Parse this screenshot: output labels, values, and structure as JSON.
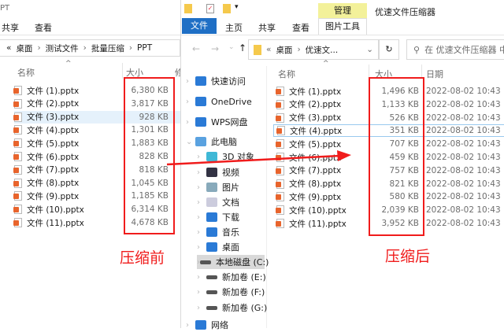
{
  "left": {
    "title": "PT",
    "tabs": [
      "共享",
      "查看"
    ],
    "breadcrumb": [
      "桌面",
      "测试文件",
      "批量压缩",
      "PPT"
    ],
    "columns": {
      "name": "名称",
      "size": "大小",
      "modified": "修"
    },
    "files": [
      {
        "name": "文件 (1).pptx",
        "size": "6,380 KB"
      },
      {
        "name": "文件 (2).pptx",
        "size": "3,817 KB"
      },
      {
        "name": "文件 (3).pptx",
        "size": "928 KB"
      },
      {
        "name": "文件 (4).pptx",
        "size": "1,301 KB"
      },
      {
        "name": "文件 (5).pptx",
        "size": "1,883 KB"
      },
      {
        "name": "文件 (6).pptx",
        "size": "828 KB"
      },
      {
        "name": "文件 (7).pptx",
        "size": "818 KB"
      },
      {
        "name": "文件 (8).pptx",
        "size": "1,045 KB"
      },
      {
        "name": "文件 (9).pptx",
        "size": "1,185 KB"
      },
      {
        "name": "文件 (10).pptx",
        "size": "6,314 KB"
      },
      {
        "name": "文件 (11).pptx",
        "size": "4,678 KB"
      }
    ],
    "annotation": "压缩前"
  },
  "right": {
    "title": "优速文件压缩器",
    "context_tab": "管理",
    "context_subtab": "图片工具",
    "tabs": [
      "文件",
      "主页",
      "共享",
      "查看"
    ],
    "breadcrumb": [
      "桌面",
      "优速文..."
    ],
    "search_placeholder": "在 优速文件压缩器 中",
    "columns": {
      "name": "名称",
      "size": "大小",
      "date": "日期"
    },
    "sidebar": [
      {
        "label": "快速访问",
        "icon": "star-icon"
      },
      {
        "label": "OneDrive",
        "icon": "cloud-icon"
      },
      {
        "label": "WPS网盘",
        "icon": "cloud-icon"
      },
      {
        "label": "此电脑",
        "icon": "computer-icon"
      },
      {
        "label": "3D 对象",
        "icon": "cube-icon"
      },
      {
        "label": "视频",
        "icon": "video-icon"
      },
      {
        "label": "图片",
        "icon": "picture-icon"
      },
      {
        "label": "文档",
        "icon": "document-icon"
      },
      {
        "label": "下载",
        "icon": "download-icon"
      },
      {
        "label": "音乐",
        "icon": "music-icon"
      },
      {
        "label": "桌面",
        "icon": "desktop-icon"
      },
      {
        "label": "本地磁盘 (C:)",
        "icon": "drive-icon"
      },
      {
        "label": "新加卷 (E:)",
        "icon": "drive-icon"
      },
      {
        "label": "新加卷 (F:)",
        "icon": "drive-icon"
      },
      {
        "label": "新加卷 (G:)",
        "icon": "drive-icon"
      },
      {
        "label": "网络",
        "icon": "network-icon"
      }
    ],
    "files": [
      {
        "name": "文件 (1).pptx",
        "size": "1,496 KB",
        "date": "2022-08-02 10:43"
      },
      {
        "name": "文件 (2).pptx",
        "size": "1,133 KB",
        "date": "2022-08-02 10:43"
      },
      {
        "name": "文件 (3).pptx",
        "size": "526 KB",
        "date": "2022-08-02 10:43"
      },
      {
        "name": "文件 (4).pptx",
        "size": "351 KB",
        "date": "2022-08-02 10:43"
      },
      {
        "name": "文件 (5).pptx",
        "size": "707 KB",
        "date": "2022-08-02 10:43"
      },
      {
        "name": "文件 (6).pptx",
        "size": "459 KB",
        "date": "2022-08-02 10:43"
      },
      {
        "name": "文件 (7).pptx",
        "size": "757 KB",
        "date": "2022-08-02 10:43"
      },
      {
        "name": "文件 (8).pptx",
        "size": "821 KB",
        "date": "2022-08-02 10:43"
      },
      {
        "name": "文件 (9).pptx",
        "size": "580 KB",
        "date": "2022-08-02 10:43"
      },
      {
        "name": "文件 (10).pptx",
        "size": "2,039 KB",
        "date": "2022-08-02 10:43"
      },
      {
        "name": "文件 (11).pptx",
        "size": "3,952 KB",
        "date": "2022-08-02 10:43"
      }
    ],
    "annotation": "压缩后"
  },
  "colors": {
    "accent": "#1f6fc5",
    "annotation": "#f01c1c",
    "context_tab": "#f3f19a"
  }
}
